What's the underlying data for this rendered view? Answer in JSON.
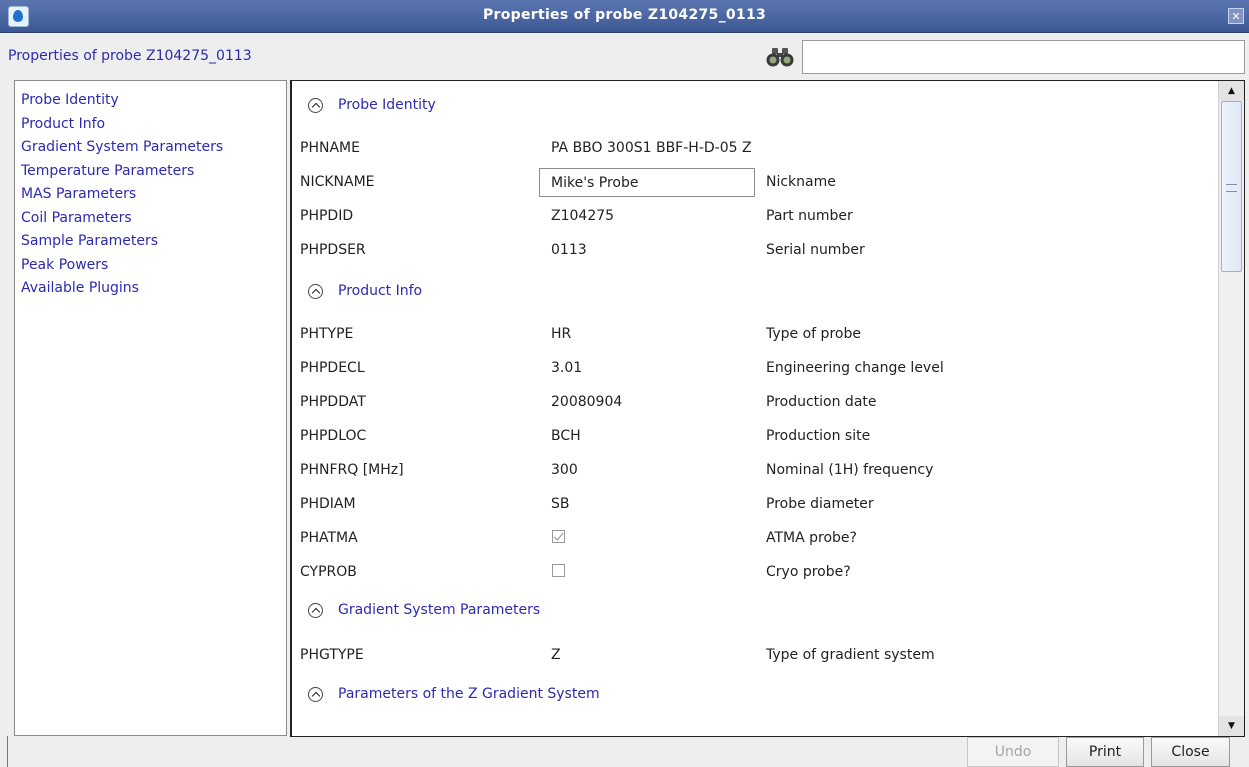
{
  "window": {
    "title": "Properties of probe  Z104275_0113",
    "header_label": "Properties of probe  Z104275_0113",
    "search_value": ""
  },
  "nav": {
    "items": [
      {
        "label": "Probe Identity"
      },
      {
        "label": "Product Info"
      },
      {
        "label": "Gradient System Parameters"
      },
      {
        "label": "Temperature Parameters"
      },
      {
        "label": "MAS Parameters"
      },
      {
        "label": "Coil Parameters"
      },
      {
        "label": "Sample Parameters"
      },
      {
        "label": "Peak Powers"
      },
      {
        "label": "Available Plugins"
      }
    ]
  },
  "sections": {
    "probe_identity": {
      "title": "Probe Identity",
      "rows": {
        "phname": {
          "name": "PHNAME",
          "value": "PA BBO 300S1 BBF-H-D-05 Z",
          "desc": ""
        },
        "nickname": {
          "name": "NICKNAME",
          "value": "Mike's Probe",
          "desc": "Nickname"
        },
        "phpdid": {
          "name": "PHPDID",
          "value": "Z104275",
          "desc": "Part number"
        },
        "phpdser": {
          "name": "PHPDSER",
          "value": "0113",
          "desc": "Serial number"
        }
      }
    },
    "product_info": {
      "title": "Product Info",
      "rows": {
        "phtype": {
          "name": "PHTYPE",
          "value": "HR",
          "desc": "Type of probe"
        },
        "phpdecl": {
          "name": "PHPDECL",
          "value": "3.01",
          "desc": "Engineering change level"
        },
        "phpddat": {
          "name": "PHPDDAT",
          "value": "20080904",
          "desc": "Production date"
        },
        "phpdloc": {
          "name": "PHPDLOC",
          "value": "BCH",
          "desc": "Production site"
        },
        "phnfrq": {
          "name": "PHNFRQ [MHz]",
          "value": "300",
          "desc": "Nominal (1H) frequency"
        },
        "phdiam": {
          "name": "PHDIAM",
          "value": "SB",
          "desc": "Probe diameter"
        },
        "phatma": {
          "name": "PHATMA",
          "checked": true,
          "desc": "ATMA probe?"
        },
        "cyprob": {
          "name": "CYPROB",
          "checked": false,
          "desc": "Cryo probe?"
        }
      }
    },
    "gradient_system": {
      "title": "Gradient System Parameters",
      "rows": {
        "phgtype": {
          "name": "PHGTYPE",
          "value": "Z",
          "desc": "Type of gradient system"
        }
      }
    },
    "z_gradient": {
      "title": "Parameters of the Z Gradient System"
    }
  },
  "buttons": {
    "undo": "Undo",
    "print": "Print",
    "close": "Close"
  },
  "icons": {
    "app": "app-icon",
    "close": "close-icon",
    "search": "binoculars-icon",
    "section_toggle": "collapse-up-icon",
    "scroll_up": "scroll-up-arrow-icon",
    "scroll_down": "scroll-down-arrow-icon"
  },
  "colors": {
    "titlebar": "#3d5995",
    "link_text": "#2d2aae",
    "background": "#eeeeee"
  }
}
